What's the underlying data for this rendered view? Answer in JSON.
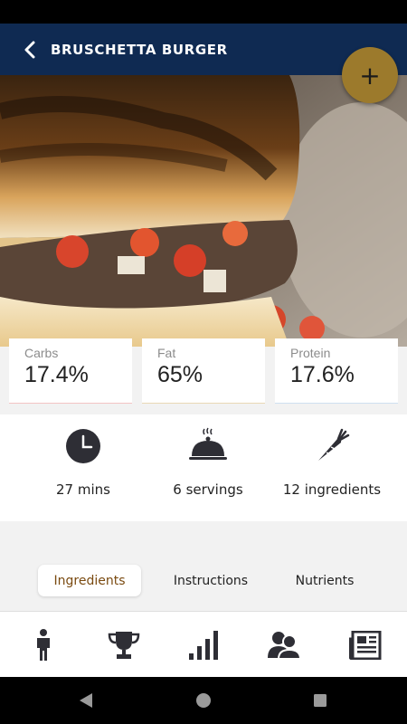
{
  "header": {
    "title": "BRUSCHETTA BURGER"
  },
  "fab": {
    "label": "+"
  },
  "macros": [
    {
      "label": "Carbs",
      "value": "17.4%"
    },
    {
      "label": "Fat",
      "value": "65%"
    },
    {
      "label": "Protein",
      "value": "17.6%"
    }
  ],
  "info": {
    "time": "27 mins",
    "servings": "6 servings",
    "ingredients": "12 ingredients"
  },
  "tabs": [
    "Ingredients",
    "Instructions",
    "Nutrients"
  ],
  "bottom_nav": [
    "person-icon",
    "trophy-icon",
    "stats-icon",
    "contacts-icon",
    "news-icon"
  ],
  "colors": {
    "header": "#0f2a52",
    "fab": "#9c7a2c",
    "active_tab_text": "#7a4a10"
  }
}
